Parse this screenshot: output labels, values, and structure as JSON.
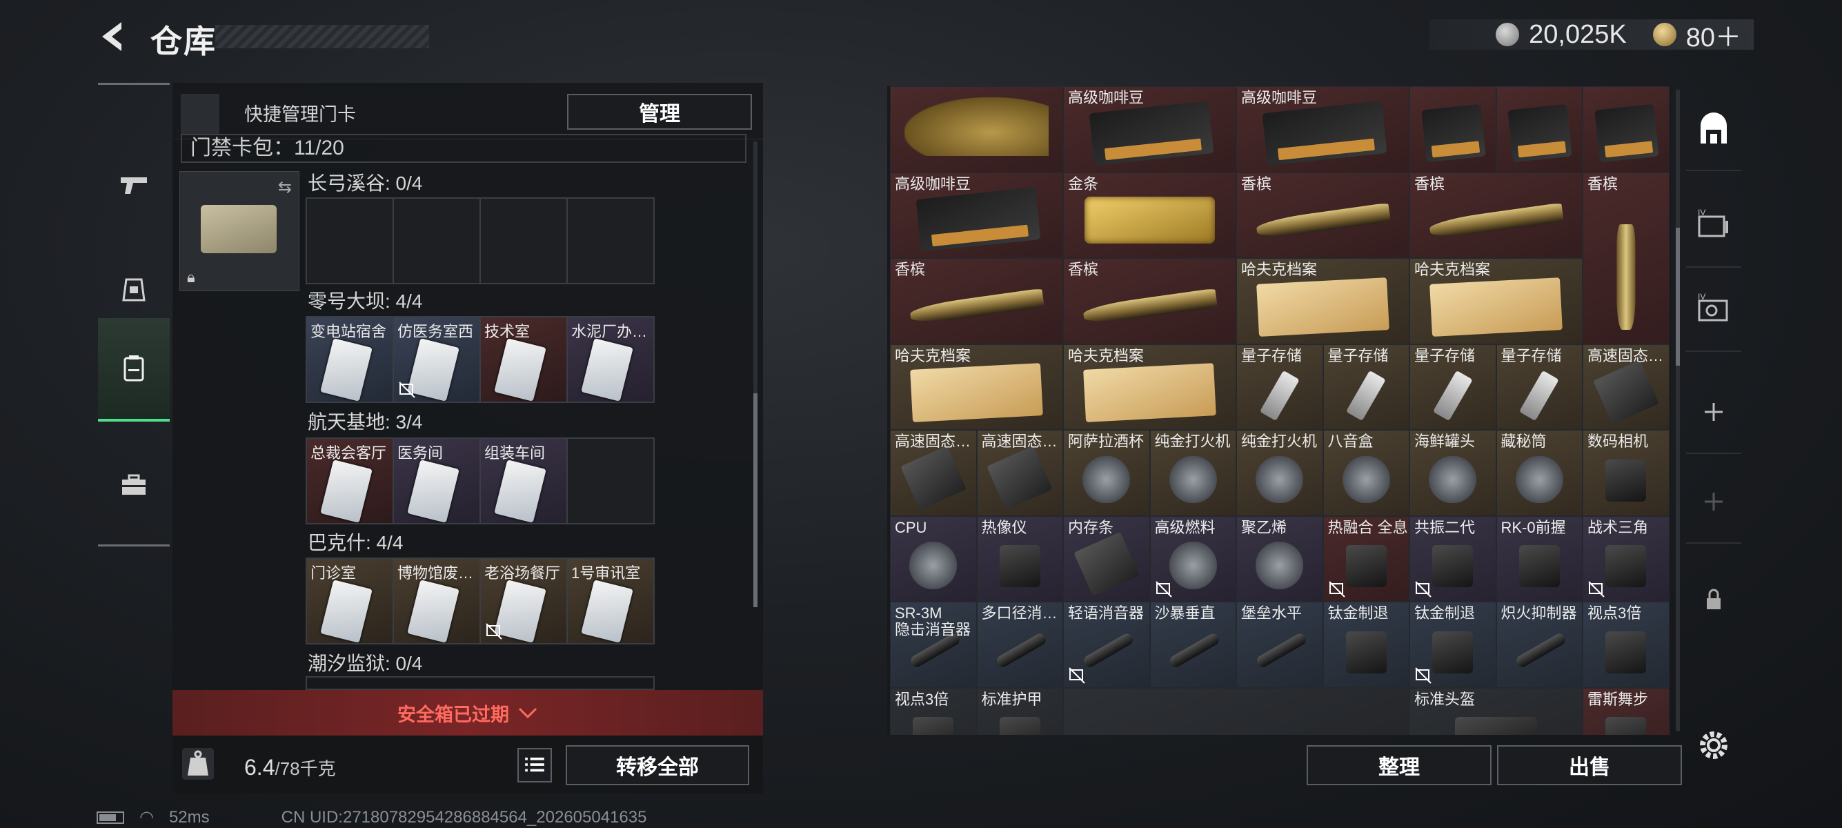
{
  "header": {
    "title": "仓库",
    "currency_main": "20,025K",
    "currency_secondary": "80＋"
  },
  "left_panel": {
    "quick_manage_label": "快捷管理门卡",
    "manage_button": "管理",
    "keypack_label": "门禁卡包：11/20",
    "sections": [
      {
        "title": "长弓溪谷: 0/4",
        "slots": [
          {
            "label": "",
            "tone": "empty"
          },
          {
            "label": "",
            "tone": "empty"
          },
          {
            "label": "",
            "tone": "empty"
          },
          {
            "label": "",
            "tone": "empty"
          }
        ]
      },
      {
        "title": "零号大坝: 4/4",
        "slots": [
          {
            "label": "变电站宿舍",
            "tone": "blue"
          },
          {
            "label": "仿医务室西",
            "tone": "blue",
            "nobind": true
          },
          {
            "label": "技术室",
            "tone": "red"
          },
          {
            "label": "水泥厂办…",
            "tone": "purple"
          }
        ]
      },
      {
        "title": "航天基地: 3/4",
        "slots": [
          {
            "label": "总裁会客厅",
            "tone": "red"
          },
          {
            "label": "医务间",
            "tone": "purple"
          },
          {
            "label": "组装车间",
            "tone": "purple"
          },
          {
            "label": "",
            "tone": "empty"
          }
        ]
      },
      {
        "title": "巴克什: 4/4",
        "slots": [
          {
            "label": "门诊室",
            "tone": "gold"
          },
          {
            "label": "博物馆废…",
            "tone": "gold"
          },
          {
            "label": "老浴场餐厅",
            "tone": "gold",
            "nobind": true
          },
          {
            "label": "1号审讯室",
            "tone": "gold"
          }
        ]
      },
      {
        "title": "潮汐监狱: 0/4",
        "slots": []
      }
    ],
    "safebox_expired": "安全箱已过期",
    "weight_current": "6.4",
    "weight_max": "/78千克",
    "transfer_all": "转移全部"
  },
  "status_bar": {
    "ping": "52ms",
    "uid": "CN UID:2718078295428688456​4_202605041635"
  },
  "inventory": {
    "items": [
      {
        "label": "",
        "tone": "red",
        "shape": "horse",
        "col": 0,
        "row": 0,
        "w": 1,
        "h": 1
      },
      {
        "label": "高级咖啡豆",
        "tone": "red",
        "shape": "coffee",
        "col": 1,
        "row": 0,
        "w": 1,
        "h": 1
      },
      {
        "label": "高级咖啡豆",
        "tone": "red",
        "shape": "coffee",
        "col": 2,
        "row": 0,
        "w": 1,
        "h": 1
      },
      {
        "label": "",
        "tone": "red",
        "shape": "coffee",
        "col": 3,
        "row": 0,
        "w": 1,
        "h": 1
      },
      {
        "label": "",
        "tone": "red",
        "shape": "coffee",
        "col": 4,
        "row": 0,
        "w": 1,
        "h": 1
      },
      {
        "label": "",
        "tone": "red",
        "shape": "coffee",
        "col": 5,
        "row": 0,
        "w": 1,
        "h": 1
      },
      {
        "label": "高级咖啡豆",
        "tone": "red",
        "shape": "coffee",
        "col": 0,
        "row": 1,
        "w": 1,
        "h": 1
      },
      {
        "label": "金条",
        "tone": "red",
        "shape": "goldbar",
        "col": 1,
        "row": 1,
        "w": 1,
        "h": 1
      },
      {
        "label": "香槟",
        "tone": "red",
        "shape": "bottle",
        "col": 2,
        "row": 1,
        "w": 1,
        "h": 1
      },
      {
        "label": "香槟",
        "tone": "red",
        "shape": "bottle",
        "col": 3,
        "row": 1,
        "w": 1,
        "h": 1
      },
      {
        "label": "香槟",
        "tone": "red",
        "shape": "bottle-v",
        "col": 5,
        "row": 1,
        "w": 1,
        "h": 2
      },
      {
        "label": "香槟",
        "tone": "red",
        "shape": "bottle",
        "col": 0,
        "row": 2,
        "w": 1,
        "h": 1
      },
      {
        "label": "香槟",
        "tone": "red",
        "shape": "bottle",
        "col": 1,
        "row": 2,
        "w": 1,
        "h": 1
      },
      {
        "label": "哈夫克档案",
        "tone": "gold",
        "shape": "folder",
        "col": 2,
        "row": 2,
        "w": 1,
        "h": 1
      },
      {
        "label": "哈夫克档案",
        "tone": "gold",
        "shape": "folder",
        "col": 3,
        "row": 2,
        "w": 1,
        "h": 1
      },
      {
        "label": "哈夫克档案",
        "tone": "gold",
        "shape": "folder",
        "col": 0,
        "row": 3,
        "w": 1,
        "h": 1
      },
      {
        "label": "哈夫克档案",
        "tone": "gold",
        "shape": "folder",
        "col": 1,
        "row": 3,
        "w": 1,
        "h": 1
      },
      {
        "label": "量子存储",
        "tone": "gold",
        "shape": "usb",
        "col": 4,
        "row": 3,
        "w": 0.5,
        "h": 1,
        "sub": 0
      },
      {
        "label": "量子存储",
        "tone": "gold",
        "shape": "usb",
        "col": 4,
        "row": 3,
        "w": 0.5,
        "h": 1,
        "sub": 1
      },
      {
        "label": "量子存储",
        "tone": "gold",
        "shape": "usb",
        "col": 6,
        "row": 3,
        "w": 0.5,
        "h": 1,
        "sub": 0
      },
      {
        "label": "量子存储",
        "tone": "gold",
        "shape": "usb",
        "col": 6,
        "row": 3,
        "w": 0.5,
        "h": 1,
        "sub": 1
      },
      {
        "label": "高速固态…",
        "tone": "gold",
        "shape": "ssd",
        "col": 10,
        "row": 3,
        "w": 0.5,
        "h": 1,
        "sub": 0
      },
      {
        "label": "高速固态…",
        "tone": "gold",
        "shape": "ssd",
        "col": 0,
        "row": 4,
        "w": 0.5,
        "h": 1,
        "sub": 0
      },
      {
        "label": "高速固态…",
        "tone": "gold",
        "shape": "ssd",
        "col": 0,
        "row": 4,
        "w": 0.5,
        "h": 1,
        "sub": 1
      },
      {
        "label": "阿萨拉酒杯",
        "tone": "gold",
        "shape": "generic",
        "col": 2,
        "row": 4,
        "w": 0.5,
        "h": 1,
        "sub": 0
      },
      {
        "label": "纯金打火机",
        "tone": "gold",
        "shape": "generic",
        "col": 2,
        "row": 4,
        "w": 0.5,
        "h": 1,
        "sub": 1
      },
      {
        "label": "纯金打火机",
        "tone": "gold",
        "shape": "generic",
        "col": 4,
        "row": 4,
        "w": 0.5,
        "h": 1,
        "sub": 0
      },
      {
        "label": "八音盒",
        "tone": "gold",
        "shape": "generic",
        "col": 4,
        "row": 4,
        "w": 0.5,
        "h": 1,
        "sub": 1
      },
      {
        "label": "海鲜罐头",
        "tone": "gold",
        "shape": "generic",
        "col": 6,
        "row": 4,
        "w": 0.5,
        "h": 1,
        "sub": 0
      },
      {
        "label": "藏秘筒",
        "tone": "gold",
        "shape": "generic",
        "col": 6,
        "row": 4,
        "w": 0.5,
        "h": 1,
        "sub": 1
      },
      {
        "label": "数码相机",
        "tone": "gold",
        "shape": "dark-part",
        "col": 10,
        "row": 4,
        "w": 0.5,
        "h": 1,
        "sub": 0
      },
      {
        "label": "CPU",
        "tone": "purple",
        "shape": "generic",
        "col": 0,
        "row": 5,
        "w": 0.5,
        "h": 1,
        "sub": 0
      },
      {
        "label": "热像仪",
        "tone": "purple",
        "shape": "dark-part",
        "col": 0,
        "row": 5,
        "w": 0.5,
        "h": 1,
        "sub": 1
      },
      {
        "label": "内存条",
        "tone": "purple",
        "shape": "ssd",
        "col": 2,
        "row": 5,
        "w": 0.5,
        "h": 1,
        "sub": 0
      },
      {
        "label": "高级燃料",
        "tone": "purple",
        "shape": "generic",
        "col": 2,
        "row": 5,
        "w": 0.5,
        "h": 1,
        "sub": 1,
        "nobind": true
      },
      {
        "label": "聚乙烯",
        "tone": "purple",
        "shape": "generic",
        "col": 4,
        "row": 5,
        "w": 0.5,
        "h": 1,
        "sub": 0
      },
      {
        "label": "热融合 全息",
        "tone": "red",
        "shape": "dark-part",
        "col": 4,
        "row": 5,
        "w": 0.5,
        "h": 1,
        "sub": 1,
        "nobind": true
      },
      {
        "label": "共振二代",
        "tone": "purple",
        "shape": "dark-part",
        "col": 6,
        "row": 5,
        "w": 0.5,
        "h": 1,
        "sub": 0,
        "nobind": true
      },
      {
        "label": "RK-0前握",
        "tone": "purple",
        "shape": "dark-part",
        "col": 6,
        "row": 5,
        "w": 0.5,
        "h": 1,
        "sub": 1
      },
      {
        "label": "战术三角",
        "tone": "purple",
        "shape": "dark-part",
        "col": 10,
        "row": 5,
        "w": 0.5,
        "h": 1,
        "sub": 0,
        "nobind": true
      },
      {
        "label": "SR-3M 隐击消音器",
        "tone": "blue",
        "shape": "pipe",
        "col": 0,
        "row": 6,
        "w": 0.5,
        "h": 1,
        "sub": 0
      },
      {
        "label": "多口径消…",
        "tone": "blue",
        "shape": "pipe",
        "col": 0,
        "row": 6,
        "w": 0.5,
        "h": 1,
        "sub": 1
      },
      {
        "label": "轻语消音器",
        "tone": "blue",
        "shape": "pipe",
        "col": 2,
        "row": 6,
        "w": 0.5,
        "h": 1,
        "sub": 0,
        "nobind": true
      },
      {
        "label": "沙暴垂直",
        "tone": "blue",
        "shape": "pipe",
        "col": 2,
        "row": 6,
        "w": 0.5,
        "h": 1,
        "sub": 1
      },
      {
        "label": "堡垒水平",
        "tone": "blue",
        "shape": "pipe",
        "col": 4,
        "row": 6,
        "w": 0.5,
        "h": 1,
        "sub": 0
      },
      {
        "label": "钛金制退",
        "tone": "blue",
        "shape": "dark-part",
        "col": 4,
        "row": 6,
        "w": 0.5,
        "h": 1,
        "sub": 1
      },
      {
        "label": "钛金制退",
        "tone": "blue",
        "shape": "dark-part",
        "col": 6,
        "row": 6,
        "w": 0.5,
        "h": 1,
        "sub": 0,
        "nobind": true
      },
      {
        "label": "炽火抑制器",
        "tone": "blue",
        "shape": "pipe",
        "col": 6,
        "row": 6,
        "w": 0.5,
        "h": 1,
        "sub": 1
      },
      {
        "label": "视点3倍",
        "tone": "blue",
        "shape": "dark-part",
        "col": 10,
        "row": 6,
        "w": 0.5,
        "h": 1,
        "sub": 0
      },
      {
        "label": "视点3倍",
        "tone": "gray",
        "shape": "dark-part",
        "col": 0,
        "row": 7,
        "w": 0.5,
        "h": 1,
        "sub": 0
      },
      {
        "label": "标准护甲",
        "tone": "gray",
        "shape": "dark-part",
        "col": 0,
        "row": 7,
        "w": 0.5,
        "h": 1,
        "sub": 1
      },
      {
        "label": "",
        "tone": "gray",
        "shape": "none",
        "col": 2,
        "row": 7,
        "w": 1,
        "h": 1
      },
      {
        "label": "标准头盔",
        "tone": "gray",
        "shape": "dark-part",
        "col": 6,
        "row": 7,
        "w": 1,
        "h": 1
      },
      {
        "label": "雷斯舞步",
        "tone": "red",
        "shape": "dark-part",
        "col": 10,
        "row": 7,
        "w": 0.5,
        "h": 1,
        "sub": 0
      }
    ]
  },
  "bottom_right": {
    "sort_button": "整理",
    "sell_button": "出售"
  },
  "colors": {
    "accent_green": "#4ee08a",
    "expired_red": "#ff6b5e"
  }
}
